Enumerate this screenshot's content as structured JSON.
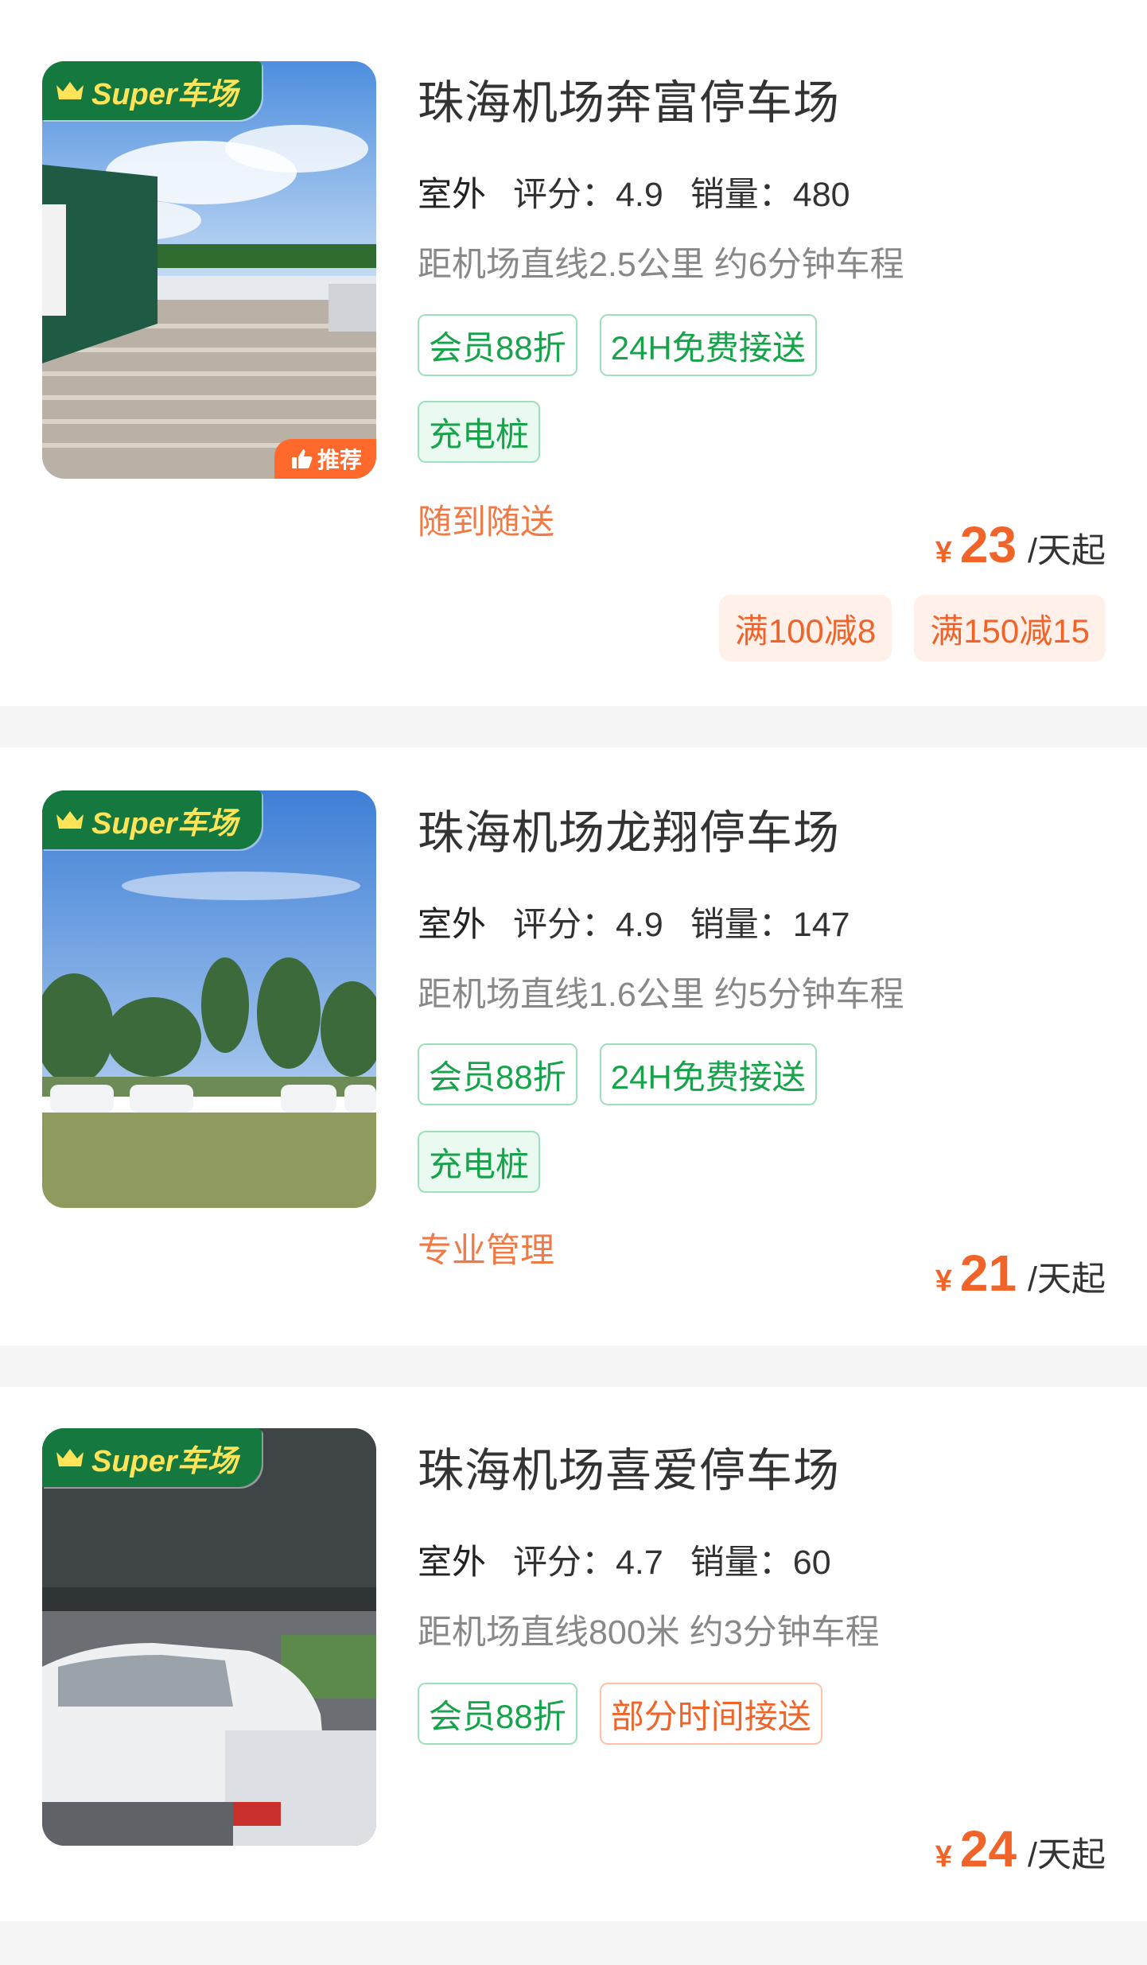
{
  "lots": [
    {
      "title": "珠海机场奔富停车场",
      "badge": "Super车场",
      "recommend": "推荐",
      "outdoor": "室外",
      "rating_text": "评分：4.9",
      "sales_text": "销量：480",
      "distance": "距机场直线2.5公里 约6分钟车程",
      "tags_row1": [
        "会员88折",
        "24H免费接送"
      ],
      "tags_row2": [
        "充电桩"
      ],
      "slogan": "随到随送",
      "currency": "¥",
      "price": "23",
      "price_unit": "/天起",
      "coupons": [
        "满100减8",
        "满150减15"
      ]
    },
    {
      "title": "珠海机场龙翔停车场",
      "badge": "Super车场",
      "outdoor": "室外",
      "rating_text": "评分：4.9",
      "sales_text": "销量：147",
      "distance": "距机场直线1.6公里 约5分钟车程",
      "tags_row1": [
        "会员88折",
        "24H免费接送"
      ],
      "tags_row2": [
        "充电桩"
      ],
      "slogan": "专业管理",
      "currency": "¥",
      "price": "21",
      "price_unit": "/天起"
    },
    {
      "title": "珠海机场喜爱停车场",
      "badge": "Super车场",
      "outdoor": "室外",
      "rating_text": "评分：4.7",
      "sales_text": "销量：60",
      "distance": "距机场直线800米 约3分钟车程",
      "tags_row1": [
        "会员88折",
        "部分时间接送"
      ],
      "currency": "¥",
      "price": "24",
      "price_unit": "/天起"
    }
  ],
  "icons": {
    "badge_icon": "crown-icon",
    "recommend_icon": "thumbs-up-icon"
  },
  "colors": {
    "accent_orange": "#f0642a",
    "tag_green": "#16a34a",
    "badge_green": "#14783f",
    "badge_text": "#ffe45a"
  }
}
